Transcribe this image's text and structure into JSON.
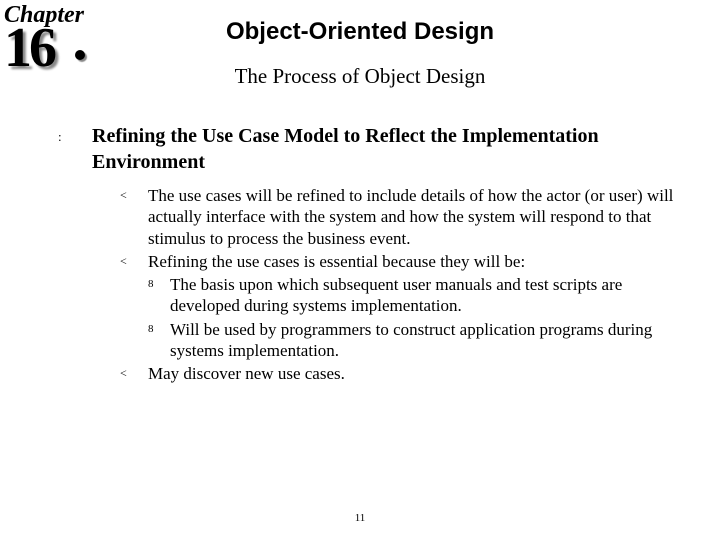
{
  "chapter": {
    "label": "Chapter",
    "number": "16"
  },
  "title": "Object-Oriented Design",
  "subtitle": "The Process of Object Design",
  "heading": "Refining the Use Case Model to Reflect the Implementation Environment",
  "items": [
    {
      "text": "The use cases will be refined to include details of how the actor (or user) will actually interface with the system and how the system will respond to that stimulus to process the business event."
    },
    {
      "text": "Refining the use cases is essential because they will be:",
      "sub": [
        "The basis upon which subsequent user manuals and test scripts are developed during systems implementation.",
        "Will be used by programmers to construct application programs during systems implementation."
      ]
    },
    {
      "text": "May discover new use cases."
    }
  ],
  "bullets": {
    "l1": ":",
    "l2": "<",
    "l3": "8"
  },
  "page": "11"
}
